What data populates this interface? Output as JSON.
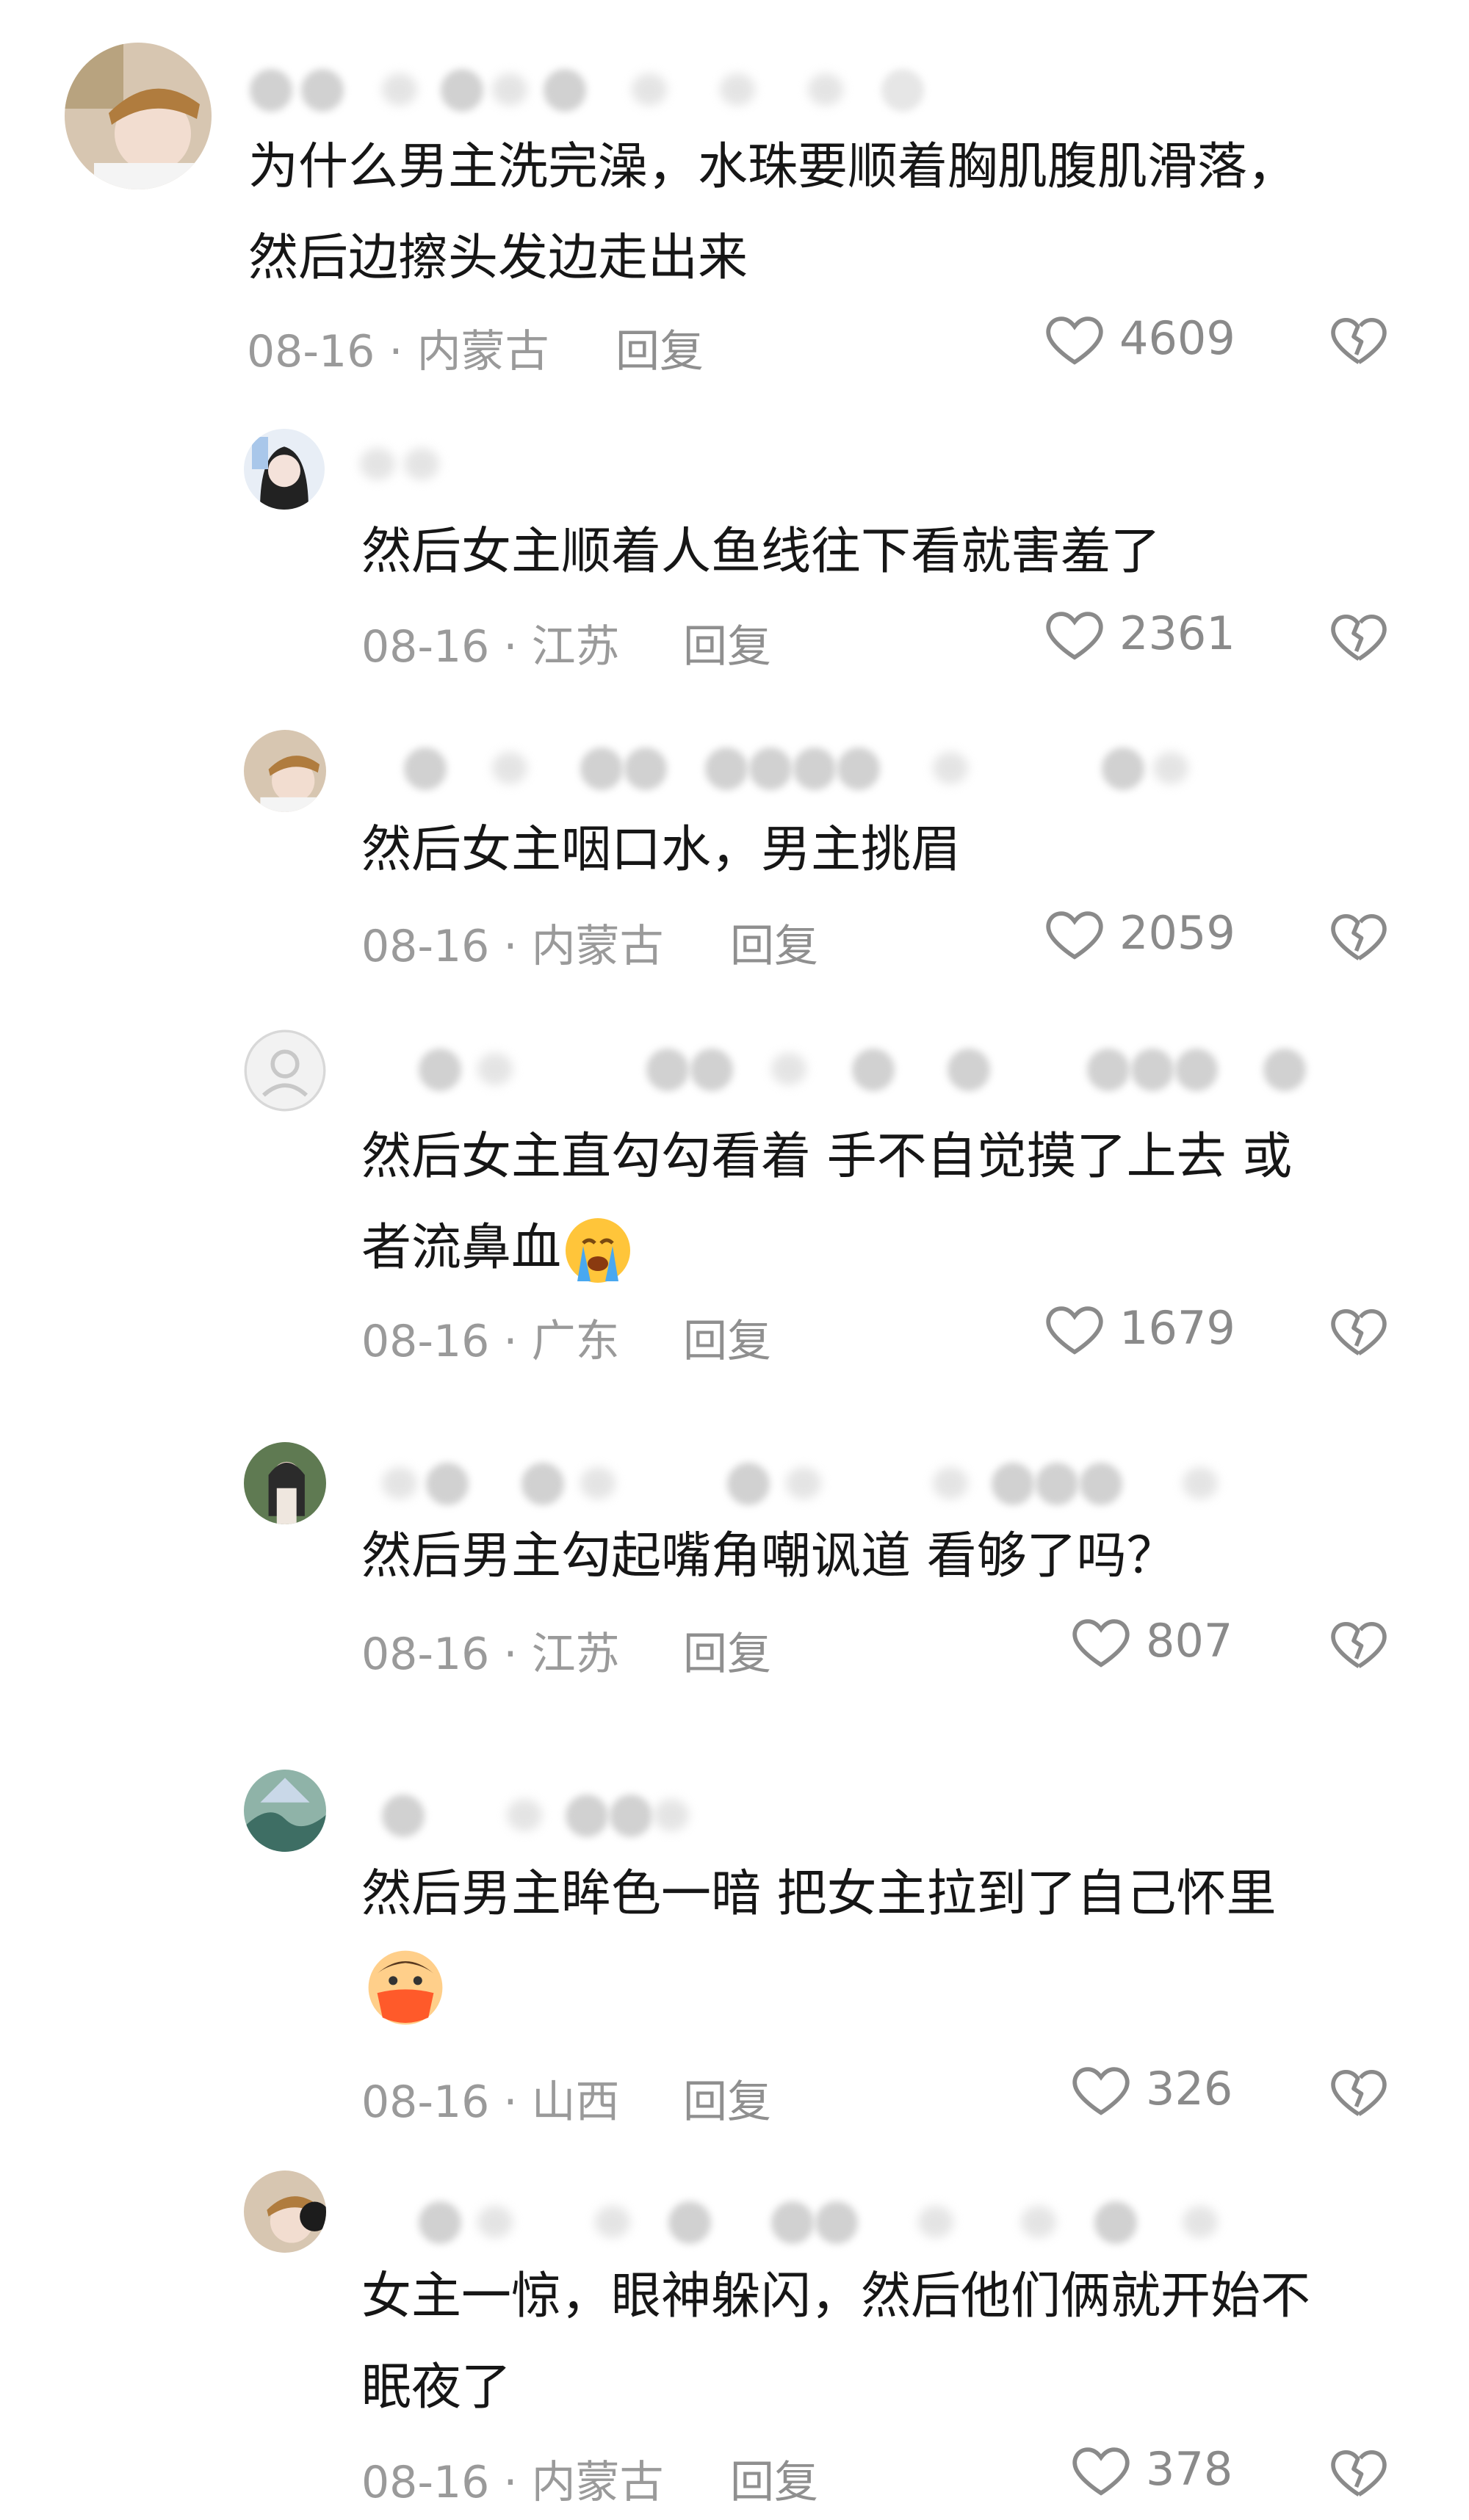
{
  "comments": [
    {
      "text_lines": [
        "为什么男主洗完澡，水珠要顺着胸肌腹肌滑落，",
        "然后边擦头发边走出来"
      ],
      "date_location": "08-16 · 内蒙古",
      "reply": "回复",
      "likes": "4609"
    },
    {
      "text_lines": [
        "然后女主顺着人鱼线往下看就害羞了"
      ],
      "date_location": "08-16 · 江苏",
      "reply": "回复",
      "likes": "2361"
    },
    {
      "text_lines": [
        "然后女主咽口水，男主挑眉"
      ],
      "date_location": "08-16 · 内蒙古",
      "reply": "回复",
      "likes": "2059"
    },
    {
      "text_lines": [
        "然后女主直勾勾看着 手不自觉摸了上去 或",
        "者流鼻血"
      ],
      "date_location": "08-16 · 广东",
      "reply": "回复",
      "likes": "1679",
      "emoji": "crying-face"
    },
    {
      "text_lines": [
        "然后男主勾起嘴角嘲讽道 看够了吗？"
      ],
      "date_location": "08-16 · 江苏",
      "reply": "回复",
      "likes": "807"
    },
    {
      "text_lines": [
        "然后男主眸色一暗 把女主拉到了自己怀里"
      ],
      "date_location": "08-16 · 山西",
      "reply": "回复",
      "likes": "326",
      "emoji": "mask-face"
    },
    {
      "text_lines": [
        "女主一惊，眼神躲闪，然后他们俩就开始不",
        "眠夜了"
      ],
      "date_location": "08-16 · 内蒙古",
      "reply": "回复",
      "likes": "378"
    }
  ],
  "colors": {
    "text": "#161616",
    "meta": "#9a9a9a",
    "icon": "#8a8a8a"
  },
  "icons": {
    "like": "heart-outline-icon",
    "dislike": "broken-heart-icon"
  }
}
